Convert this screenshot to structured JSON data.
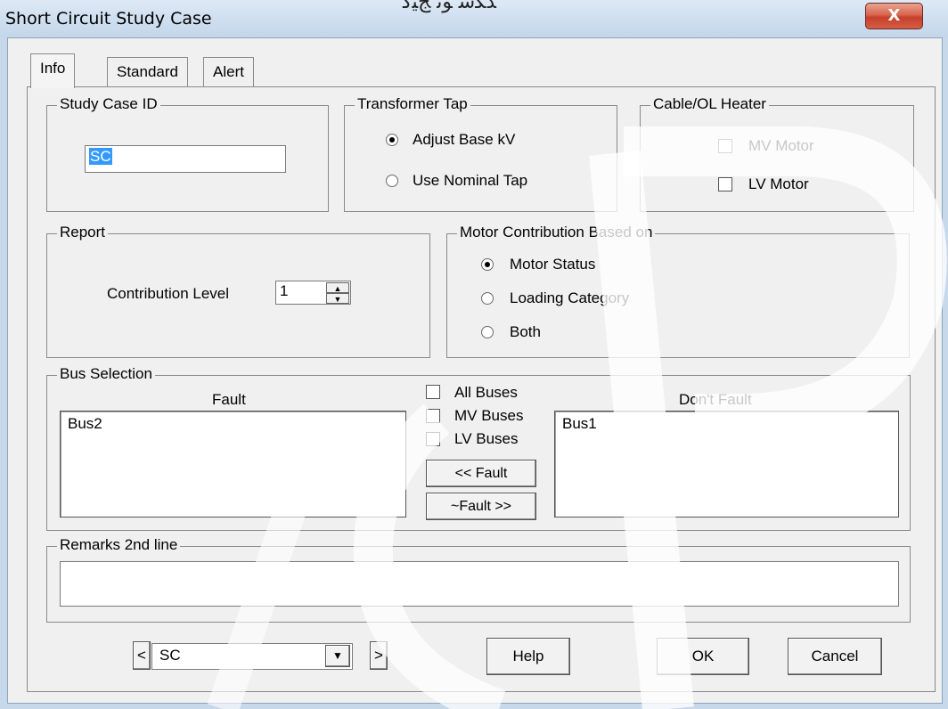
{
  "window": {
    "title": "Short Circuit Study Case",
    "title_decoration": "ﺪﻜﺳ ﻮﺗ ﺞﯿﮔ",
    "close_label": "X"
  },
  "tabs": [
    {
      "label": "Info",
      "active": true
    },
    {
      "label": "Standard",
      "active": false
    },
    {
      "label": "Alert",
      "active": false
    }
  ],
  "study_case_id": {
    "legend": "Study Case ID",
    "value": "SC"
  },
  "transformer_tap": {
    "legend": "Transformer Tap",
    "options": [
      {
        "label": "Adjust Base kV",
        "selected": true
      },
      {
        "label": "Use Nominal Tap",
        "selected": false
      }
    ]
  },
  "cable_heater": {
    "legend": "Cable/OL Heater",
    "options": [
      {
        "label": "MV Motor",
        "checked": false
      },
      {
        "label": "LV Motor",
        "checked": false
      }
    ]
  },
  "report": {
    "legend": "Report",
    "contribution_label": "Contribution Level",
    "contribution_value": "1"
  },
  "motor_contribution": {
    "legend": "Motor Contribution Based on",
    "options": [
      {
        "label": "Motor Status",
        "selected": true
      },
      {
        "label": "Loading Category",
        "selected": false
      },
      {
        "label": "Both",
        "selected": false
      }
    ]
  },
  "bus_selection": {
    "legend": "Bus Selection",
    "fault_header": "Fault",
    "dont_fault_header": "Don't Fault",
    "fault_items": [
      "Bus2"
    ],
    "dont_fault_items": [
      "Bus1"
    ],
    "filters": [
      {
        "label": "All Buses",
        "checked": false
      },
      {
        "label": "MV Buses",
        "checked": false
      },
      {
        "label": "LV Buses",
        "checked": false
      }
    ],
    "fault_button": "<< Fault",
    "unfault_button": "~Fault >>"
  },
  "remarks": {
    "legend": "Remarks 2nd line",
    "value": ""
  },
  "footer": {
    "prev_label": "<",
    "next_label": ">",
    "case_select_value": "SC",
    "help_label": "Help",
    "ok_label": "OK",
    "cancel_label": "Cancel"
  }
}
